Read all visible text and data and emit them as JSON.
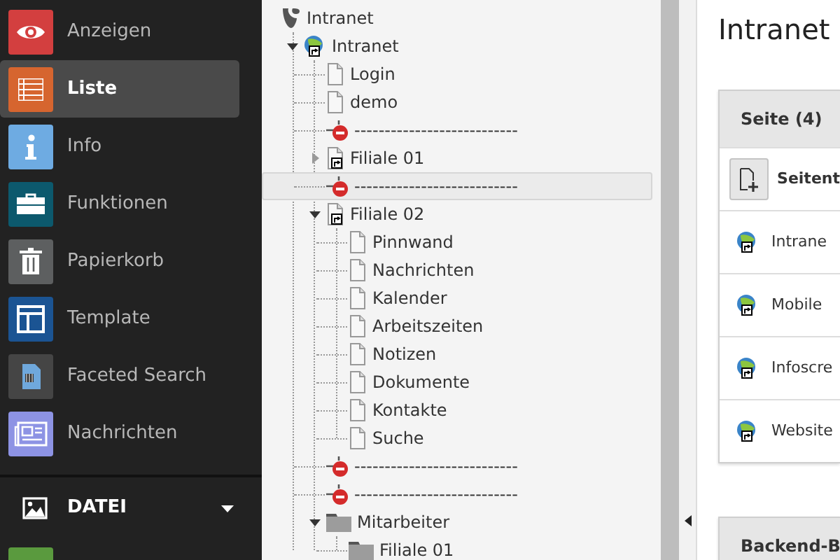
{
  "sidebar": {
    "items": [
      {
        "label": "Anzeigen",
        "color": "#d33f3f",
        "selected": false
      },
      {
        "label": "Liste",
        "color": "#d6652f",
        "selected": true
      },
      {
        "label": "Info",
        "color": "#6eabe2",
        "selected": false
      },
      {
        "label": "Funktionen",
        "color": "#0c596d",
        "selected": false
      },
      {
        "label": "Papierkorb",
        "color": "#5d5f60",
        "selected": false
      },
      {
        "label": "Template",
        "color": "#1b5493",
        "selected": false
      },
      {
        "label": "Faceted Search",
        "color": "#454545",
        "selected": false
      },
      {
        "label": "Nachrichten",
        "color": "#8d93e4",
        "selected": false
      }
    ],
    "section": {
      "label": "DATEI",
      "expanded": true
    }
  },
  "tree": {
    "items": [
      {
        "kind": "root",
        "label": "Intranet",
        "highlighted": false,
        "children": [
          {
            "kind": "site",
            "label": "Intranet",
            "expanded": true,
            "highlighted": false,
            "children": [
              {
                "kind": "page",
                "label": "Login",
                "highlighted": false
              },
              {
                "kind": "page",
                "label": "demo",
                "highlighted": false
              },
              {
                "kind": "separator",
                "label": "---------------------------",
                "highlighted": false
              },
              {
                "kind": "shortcut",
                "label": "Filiale 01",
                "expanded": false,
                "highlighted": false
              },
              {
                "kind": "separator",
                "label": "---------------------------",
                "highlighted": true
              },
              {
                "kind": "shortcut",
                "label": "Filiale 02",
                "expanded": true,
                "highlighted": false,
                "children": [
                  {
                    "kind": "page",
                    "label": "Pinnwand",
                    "highlighted": false
                  },
                  {
                    "kind": "page",
                    "label": "Nachrichten",
                    "highlighted": false
                  },
                  {
                    "kind": "page",
                    "label": "Kalender",
                    "highlighted": false
                  },
                  {
                    "kind": "page",
                    "label": "Arbeitszeiten",
                    "highlighted": false
                  },
                  {
                    "kind": "page",
                    "label": "Notizen",
                    "highlighted": false
                  },
                  {
                    "kind": "page",
                    "label": "Dokumente",
                    "highlighted": false
                  },
                  {
                    "kind": "page",
                    "label": "Kontakte",
                    "highlighted": false
                  },
                  {
                    "kind": "page",
                    "label": "Suche",
                    "highlighted": false
                  }
                ]
              },
              {
                "kind": "separator",
                "label": "---------------------------",
                "highlighted": false
              },
              {
                "kind": "separator",
                "label": "---------------------------",
                "highlighted": false
              },
              {
                "kind": "folder",
                "label": "Mitarbeiter",
                "expanded": true,
                "highlighted": false,
                "children": [
                  {
                    "kind": "folder",
                    "label": "Filiale 01",
                    "highlighted": false
                  }
                ]
              }
            ]
          }
        ]
      }
    ]
  },
  "content": {
    "title": "Intranet",
    "panels": [
      {
        "header": "Seite (4)",
        "new_label": "Seitent",
        "rows": [
          {
            "label": "Intrane"
          },
          {
            "label": "Mobile"
          },
          {
            "label": "Infoscre"
          },
          {
            "label": "Website"
          }
        ]
      },
      {
        "header": "Backend-B"
      }
    ]
  }
}
